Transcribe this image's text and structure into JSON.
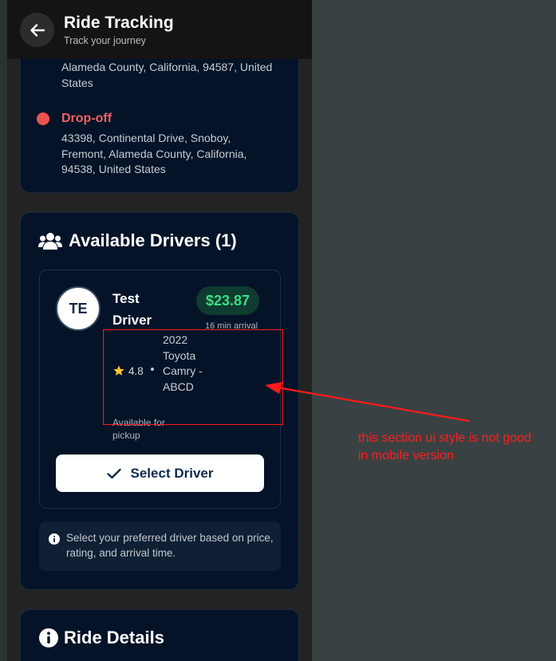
{
  "header": {
    "title": "Ride Tracking",
    "subtitle": "Track your journey"
  },
  "pickup": {
    "address_tail": "Alameda County, California, 94587, United States"
  },
  "dropoff": {
    "label": "Drop-off",
    "address": "43398, Continental Drive, Snoboy, Fremont, Alameda County, California, 94538, United States"
  },
  "drivers": {
    "title": "Available Drivers (1)",
    "card": {
      "initials": "TE",
      "name": "Test Driver",
      "price": "$23.87",
      "eta": "16 min arrival",
      "rating": "4.8",
      "vehicle": "2022 Toyota Camry - ABCD",
      "availability": "Available for pickup",
      "select_label": "Select Driver"
    },
    "info": "Select your preferred driver based on price, rating, and arrival time."
  },
  "ride_details": {
    "title": "Ride Details"
  },
  "annotation": {
    "text": "this section ui style is not good in mobile version"
  },
  "colors": {
    "card_bg": "#041327",
    "price_green": "#3ddc84",
    "dropoff_red": "#ef5350",
    "annotation_red": "#ff1a1a"
  }
}
